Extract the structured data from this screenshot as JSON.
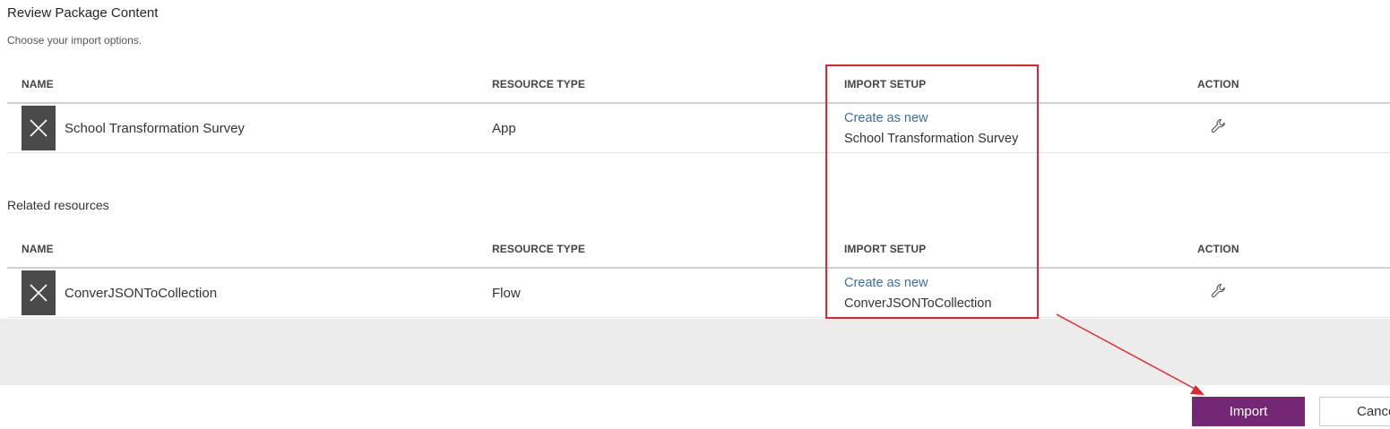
{
  "header": {
    "title": "Review Package Content",
    "subtitle": "Choose your import options."
  },
  "columns": {
    "name": "NAME",
    "resource_type": "RESOURCE TYPE",
    "import_setup": "IMPORT SETUP",
    "action": "ACTION"
  },
  "main_table": {
    "rows": [
      {
        "name": "School Transformation Survey",
        "resource_type": "App",
        "setup_link": "Create as new",
        "setup_name": "School Transformation Survey",
        "action_icon": "wrench-icon"
      }
    ]
  },
  "related": {
    "title": "Related resources",
    "rows": [
      {
        "name": "ConverJSONToCollection",
        "resource_type": "Flow",
        "setup_link": "Create as new",
        "setup_name": "ConverJSONToCollection",
        "action_icon": "wrench-icon"
      }
    ]
  },
  "footer": {
    "import_label": "Import",
    "cancel_label": "Cancel"
  },
  "colors": {
    "accent_purple": "#742774",
    "link_blue": "#3a6ea5",
    "annotation_red": "#e0262e",
    "icon_tile": "#4a4a4a"
  }
}
